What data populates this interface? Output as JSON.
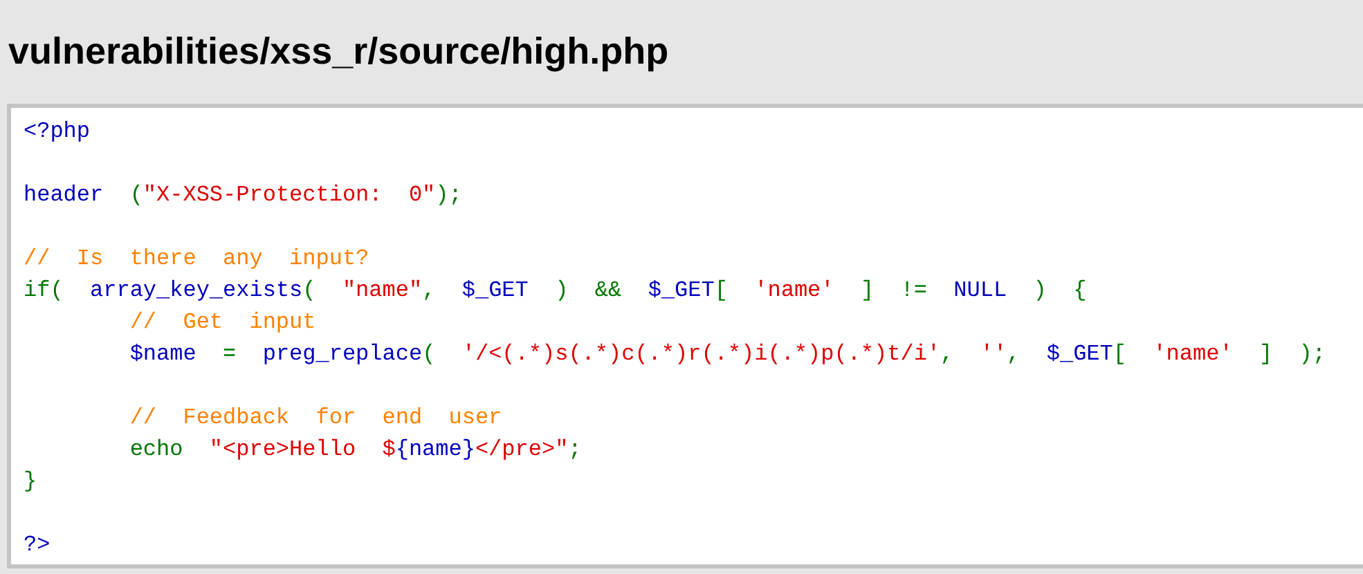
{
  "title": "vulnerabilities/xss_r/source/high.php",
  "code_lines": [
    {
      "kind": "code",
      "tokens": [
        {
          "kind": "default",
          "text": "<?php"
        }
      ]
    },
    {
      "kind": "blank"
    },
    {
      "kind": "code",
      "tokens": [
        {
          "kind": "default",
          "text": "header"
        },
        {
          "kind": "keyword",
          "text": "  ("
        },
        {
          "kind": "string",
          "text": "\"X-XSS-Protection:  0\""
        },
        {
          "kind": "keyword",
          "text": ");"
        }
      ]
    },
    {
      "kind": "blank"
    },
    {
      "kind": "code",
      "tokens": [
        {
          "kind": "comment",
          "text": "//  Is  there  any  input?"
        }
      ]
    },
    {
      "kind": "code",
      "tokens": [
        {
          "kind": "keyword",
          "text": "if(  "
        },
        {
          "kind": "default",
          "text": "array_key_exists"
        },
        {
          "kind": "keyword",
          "text": "(  "
        },
        {
          "kind": "string",
          "text": "\"name\""
        },
        {
          "kind": "keyword",
          "text": ",  "
        },
        {
          "kind": "default",
          "text": "$_GET"
        },
        {
          "kind": "keyword",
          "text": "  )  &&  "
        },
        {
          "kind": "default",
          "text": "$_GET"
        },
        {
          "kind": "keyword",
          "text": "[  "
        },
        {
          "kind": "string",
          "text": "'name'"
        },
        {
          "kind": "keyword",
          "text": "  ]  !=  "
        },
        {
          "kind": "default",
          "text": "NULL"
        },
        {
          "kind": "keyword",
          "text": "  )  {"
        }
      ]
    },
    {
      "kind": "code",
      "tokens": [
        {
          "kind": "comment",
          "text": "        //  Get  input"
        }
      ]
    },
    {
      "kind": "code",
      "tokens": [
        {
          "kind": "default",
          "text": "        $name"
        },
        {
          "kind": "keyword",
          "text": "  =  "
        },
        {
          "kind": "default",
          "text": "preg_replace"
        },
        {
          "kind": "keyword",
          "text": "(  "
        },
        {
          "kind": "string",
          "text": "'/<(.*)s(.*)c(.*)r(.*)i(.*)p(.*)t/i'"
        },
        {
          "kind": "keyword",
          "text": ",  "
        },
        {
          "kind": "string",
          "text": "''"
        },
        {
          "kind": "keyword",
          "text": ",  "
        },
        {
          "kind": "default",
          "text": "$_GET"
        },
        {
          "kind": "keyword",
          "text": "[  "
        },
        {
          "kind": "string",
          "text": "'name'"
        },
        {
          "kind": "keyword",
          "text": "  ]  );"
        }
      ]
    },
    {
      "kind": "blank"
    },
    {
      "kind": "code",
      "tokens": [
        {
          "kind": "comment",
          "text": "        //  Feedback  for  end  user"
        }
      ]
    },
    {
      "kind": "code",
      "tokens": [
        {
          "kind": "keyword",
          "text": "        echo  "
        },
        {
          "kind": "string",
          "text": "\"<pre>Hello  $"
        },
        {
          "kind": "default",
          "text": "{name}"
        },
        {
          "kind": "string",
          "text": "</pre>\""
        },
        {
          "kind": "keyword",
          "text": ";"
        }
      ]
    },
    {
      "kind": "code",
      "tokens": [
        {
          "kind": "keyword",
          "text": "}"
        }
      ]
    },
    {
      "kind": "blank"
    },
    {
      "kind": "code",
      "tokens": [
        {
          "kind": "default",
          "text": "?>"
        }
      ]
    }
  ]
}
